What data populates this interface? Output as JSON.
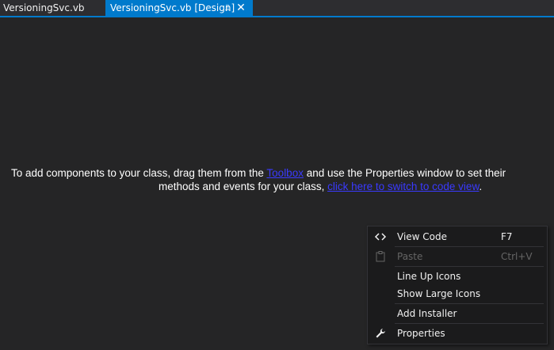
{
  "tabs": [
    {
      "label": "VersioningSvc.vb",
      "active": false
    },
    {
      "label": "VersioningSvc.vb [Design]",
      "active": true
    }
  ],
  "tab_icons": {
    "pin": "pin-icon",
    "close": "close-icon"
  },
  "message": {
    "line1_before": "To add components to your class, drag them from the ",
    "toolbox_link": "Toolbox",
    "line1_after": " and use the Properties window to set their",
    "line2_before": "methods and events for your class, ",
    "code_view_link": "click here to switch to code view",
    "line2_after": "."
  },
  "context_menu": {
    "items": [
      {
        "label": "View Code",
        "shortcut": "F7",
        "icon": "code-brackets-icon",
        "enabled": true
      },
      {
        "label": "Paste",
        "shortcut": "Ctrl+V",
        "icon": "paste-icon",
        "enabled": false
      },
      {
        "label": "Line Up Icons",
        "shortcut": "",
        "icon": "",
        "enabled": true
      },
      {
        "label": "Show Large Icons",
        "shortcut": "",
        "icon": "",
        "enabled": true
      },
      {
        "label": "Add Installer",
        "shortcut": "",
        "icon": "",
        "enabled": true,
        "highlighted": true
      },
      {
        "label": "Properties",
        "shortcut": "",
        "icon": "wrench-icon",
        "enabled": true
      }
    ]
  },
  "colors": {
    "accent": "#007acc",
    "background": "#252526",
    "menu_background": "#1b1b1c",
    "highlight_border": "#e81123",
    "link": "#3a3aff"
  }
}
